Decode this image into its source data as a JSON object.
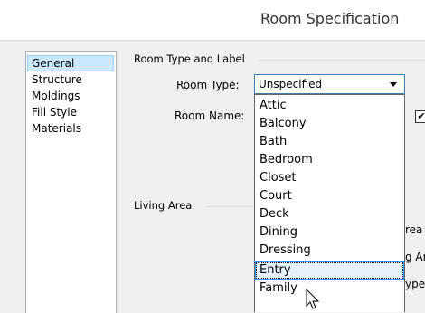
{
  "window": {
    "title": "Room Specification"
  },
  "sidebar": {
    "items": [
      {
        "label": "General",
        "selected": true
      },
      {
        "label": "Structure"
      },
      {
        "label": "Moldings"
      },
      {
        "label": "Fill Style"
      },
      {
        "label": "Materials"
      }
    ]
  },
  "room_type_group": {
    "label": "Room Type and Label",
    "room_type_label": "Room Type:",
    "room_type_value": "Unspecified",
    "room_name_label": "Room Name:"
  },
  "living_area_group": {
    "label": "Living Area"
  },
  "clipped_text": {
    "line1": "rea",
    "line2": "g Ar",
    "line3": "ype"
  },
  "dropdown": {
    "options": [
      "Attic",
      "Balcony",
      "Bath",
      "Bedroom",
      "Closet",
      "Court",
      "Deck",
      "Dining",
      "Dressing",
      "Entry",
      "Family"
    ],
    "hovered": "Entry"
  }
}
